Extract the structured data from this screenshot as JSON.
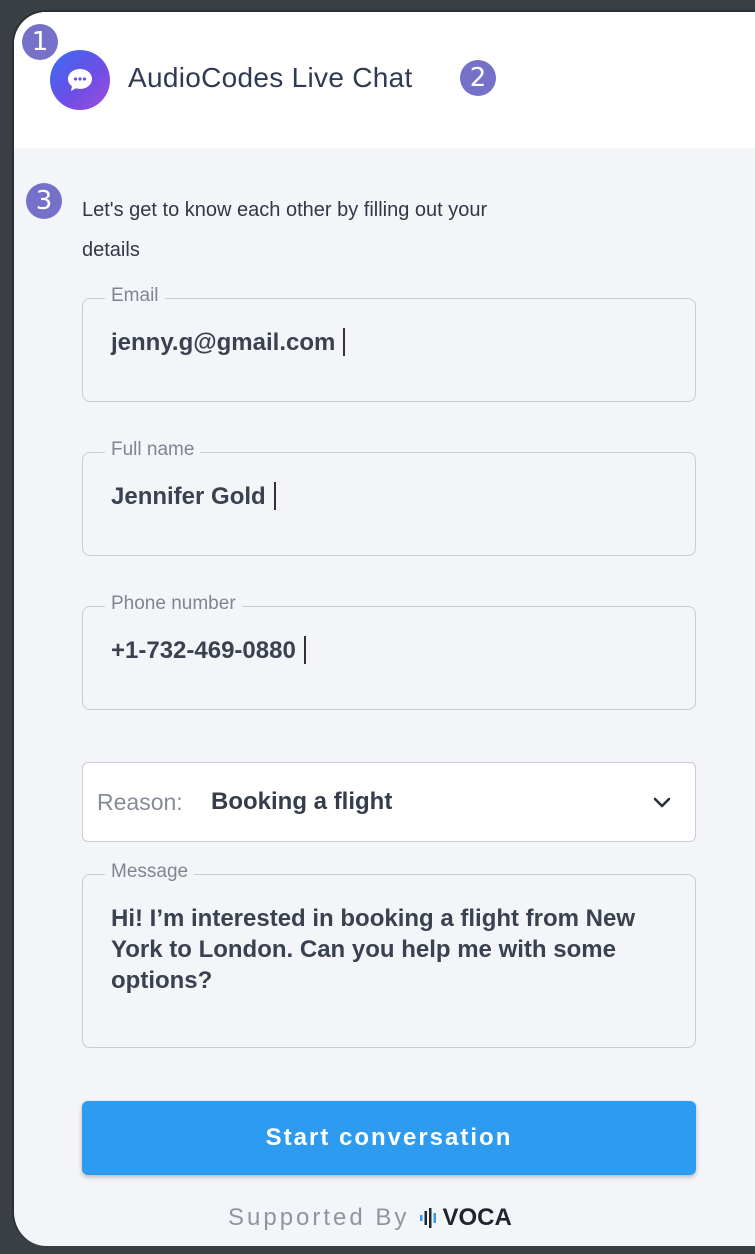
{
  "header": {
    "title": "AudioCodes Live Chat"
  },
  "annotations": [
    "1",
    "2",
    "3"
  ],
  "intro": "Let's get to know each other by filling out your details",
  "form": {
    "email": {
      "label": "Email",
      "value": "jenny.g@gmail.com"
    },
    "full_name": {
      "label": "Full name",
      "value": "Jennifer Gold"
    },
    "phone": {
      "label": "Phone number",
      "value": "+1-732-469-0880"
    },
    "reason": {
      "label": "Reason:",
      "value": "Booking a flight"
    },
    "message": {
      "label": "Message",
      "value": "Hi! I’m interested in booking a flight from New York to London. Can you help me with some options?"
    }
  },
  "submit_label": "Start conversation",
  "footer": {
    "supported_by": "Supported By",
    "brand": "VOCA"
  },
  "colors": {
    "accent": "#2d9bf0",
    "badge": "#7571c9",
    "logo_gradient_start": "#3b6cf3",
    "logo_gradient_end": "#a24bdc"
  },
  "icons": {
    "logo": "chat-bubble-icon",
    "reason": "chevron-down-icon",
    "brand": "voice-wave-icon"
  }
}
